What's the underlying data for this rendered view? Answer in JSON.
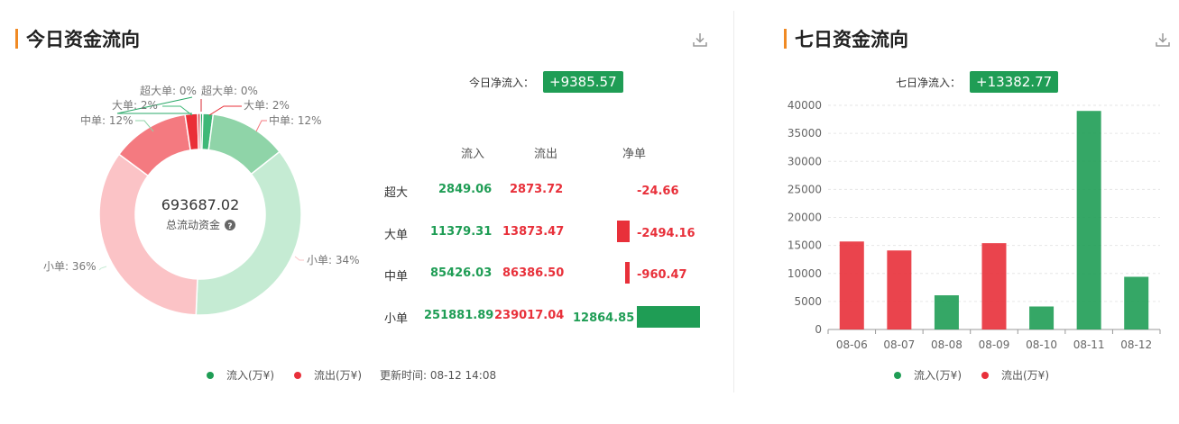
{
  "left": {
    "title": "今日资金流向",
    "net_label": "今日净流入：",
    "net_value": "+9385.57",
    "center_value": "693687.02",
    "center_label": "总流动资金",
    "table_headers": [
      "流入",
      "流出",
      "净单"
    ],
    "rows": [
      {
        "label": "超大",
        "in": "2849.06",
        "out": "2873.72",
        "net": "-24.66",
        "net_num": -24.66
      },
      {
        "label": "大单",
        "in": "11379.31",
        "out": "13873.47",
        "net": "-2494.16",
        "net_num": -2494.16
      },
      {
        "label": "中单",
        "in": "85426.03",
        "out": "86386.50",
        "net": "-960.47",
        "net_num": -960.47
      },
      {
        "label": "小单",
        "in": "251881.89",
        "out": "239017.04",
        "net": "12864.85",
        "net_num": 12864.85
      }
    ],
    "legend_in": "流入(万¥)",
    "legend_out": "流出(万¥)",
    "update_time": "更新时间: 08-12 14:08"
  },
  "right": {
    "title": "七日资金流向",
    "net_label": "七日净流入：",
    "net_value": "+13382.77",
    "legend_in": "流入(万¥)",
    "legend_out": "流出(万¥)"
  },
  "colors": {
    "inflow": "#1f9d55",
    "outflow": "#e8303a",
    "accent": "#f08a24"
  },
  "chart_data": [
    {
      "type": "pie",
      "labels": [
        "超大单",
        "大单",
        "中单",
        "小单",
        "小单",
        "中单",
        "大单",
        "超大单"
      ],
      "values": [
        0.41,
        1.64,
        12.31,
        36.31,
        34.46,
        12.45,
        2.0,
        0.41
      ],
      "slice_labels": [
        "超大单: 0%",
        "大单: 2%",
        "中单: 12%",
        "小单: 36%",
        "小单: 34%",
        "中单: 12%",
        "大单: 2%",
        "超大单: 0%"
      ],
      "colors": [
        "#2aa868",
        "#3fb878",
        "#8fd4a8",
        "#c5ebd3",
        "#fbc3c6",
        "#f47a80",
        "#ea2f37",
        "#d82a33"
      ]
    },
    {
      "type": "bar",
      "categories": [
        "08-06",
        "08-07",
        "08-08",
        "08-09",
        "08-10",
        "08-11",
        "08-12"
      ],
      "values": [
        15700,
        14100,
        6100,
        15400,
        4100,
        39000,
        9400
      ],
      "directions": [
        "out",
        "out",
        "in",
        "out",
        "in",
        "in",
        "in"
      ],
      "ylim": [
        0,
        40000
      ],
      "yticks": [
        0,
        5000,
        10000,
        15000,
        20000,
        25000,
        30000,
        35000,
        40000
      ],
      "grid": true
    }
  ]
}
